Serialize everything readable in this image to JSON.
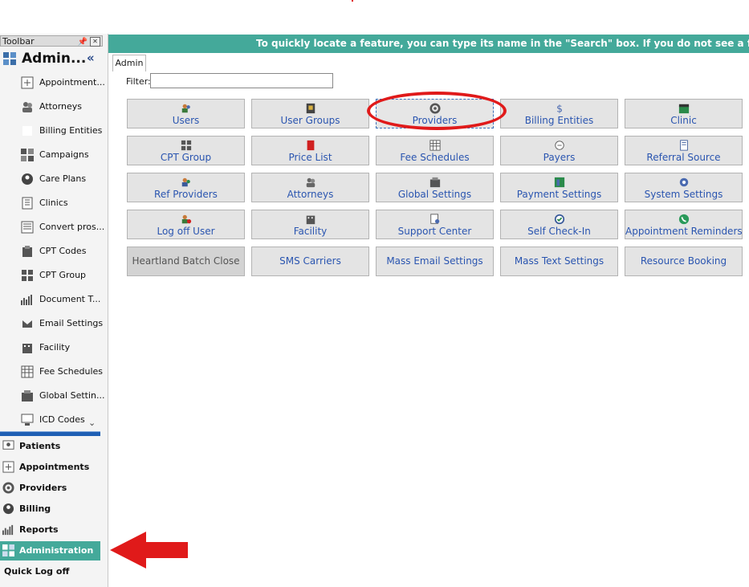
{
  "toolbar": {
    "header": "Toolbar",
    "section_title": "Admin...",
    "collapse_glyph": "«",
    "items": [
      {
        "label": "Appointment...",
        "icon": "appointment-icon"
      },
      {
        "label": "Attorneys",
        "icon": "attorneys-icon"
      },
      {
        "label": "Billing Entities",
        "icon": "billing-entities-icon"
      },
      {
        "label": "Campaigns",
        "icon": "campaigns-icon"
      },
      {
        "label": "Care Plans",
        "icon": "care-plans-icon"
      },
      {
        "label": "Clinics",
        "icon": "clinics-icon"
      },
      {
        "label": "Convert pros...",
        "icon": "convert-prospects-icon"
      },
      {
        "label": "CPT Codes",
        "icon": "cpt-codes-icon"
      },
      {
        "label": "CPT Group",
        "icon": "cpt-group-icon"
      },
      {
        "label": "Document T...",
        "icon": "document-templates-icon"
      },
      {
        "label": "Email Settings",
        "icon": "email-settings-icon"
      },
      {
        "label": "Facility",
        "icon": "facility-icon"
      },
      {
        "label": "Fee Schedules",
        "icon": "fee-schedules-icon"
      },
      {
        "label": "Global Settin...",
        "icon": "global-settings-icon"
      },
      {
        "label": "ICD Codes",
        "icon": "icd-codes-icon"
      }
    ]
  },
  "nav": [
    {
      "label": "Patients",
      "icon": "patients-icon"
    },
    {
      "label": "Appointments",
      "icon": "appointments-icon"
    },
    {
      "label": "Providers",
      "icon": "providers-icon"
    },
    {
      "label": "Billing",
      "icon": "billing-icon"
    },
    {
      "label": "Reports",
      "icon": "reports-icon"
    },
    {
      "label": "Administration",
      "icon": "administration-icon",
      "active": true
    },
    {
      "label": "Quick Log off"
    }
  ],
  "banner": "To quickly locate a feature, you can type its name in the \"Search\" box. If you do not see a feat",
  "tab": "Admin",
  "filter": {
    "label": "Filter:",
    "value": ""
  },
  "features": [
    {
      "label": "Users",
      "icon": "users-icon"
    },
    {
      "label": "User Groups",
      "icon": "user-groups-icon"
    },
    {
      "label": "Providers",
      "icon": "providers-icon",
      "selected": true
    },
    {
      "label": "Billing Entities",
      "icon": "dollar-icon"
    },
    {
      "label": "Clinic",
      "icon": "clinic-icon"
    },
    {
      "label": "CPT Group",
      "icon": "cpt-group-icon"
    },
    {
      "label": "Price List",
      "icon": "price-list-icon"
    },
    {
      "label": "Fee Schedules",
      "icon": "fee-schedules-icon"
    },
    {
      "label": "Payers",
      "icon": "payers-icon"
    },
    {
      "label": "Referral Source",
      "icon": "referral-source-icon"
    },
    {
      "label": "Ref Providers",
      "icon": "ref-providers-icon"
    },
    {
      "label": "Attorneys",
      "icon": "attorneys-icon"
    },
    {
      "label": "Global Settings",
      "icon": "global-settings-icon"
    },
    {
      "label": "Payment Settings",
      "icon": "payment-settings-icon"
    },
    {
      "label": "System Settings",
      "icon": "gear-icon"
    },
    {
      "label": "Log off User",
      "icon": "log-off-icon"
    },
    {
      "label": "Facility",
      "icon": "facility-icon"
    },
    {
      "label": "Support Center",
      "icon": "support-center-icon"
    },
    {
      "label": "Self Check-In",
      "icon": "self-check-in-icon"
    },
    {
      "label": "Appointment Reminders",
      "icon": "phone-icon"
    },
    {
      "label": "Heartland Batch Close",
      "disabled": true
    },
    {
      "label": "SMS Carriers"
    },
    {
      "label": "Mass Email Settings"
    },
    {
      "label": "Mass Text Settings"
    },
    {
      "label": "Resource Booking"
    }
  ],
  "colors": {
    "accent": "#44a99a",
    "link": "#2a55b0",
    "highlight": "#e01a1a",
    "splitter": "#1f5fb4"
  }
}
